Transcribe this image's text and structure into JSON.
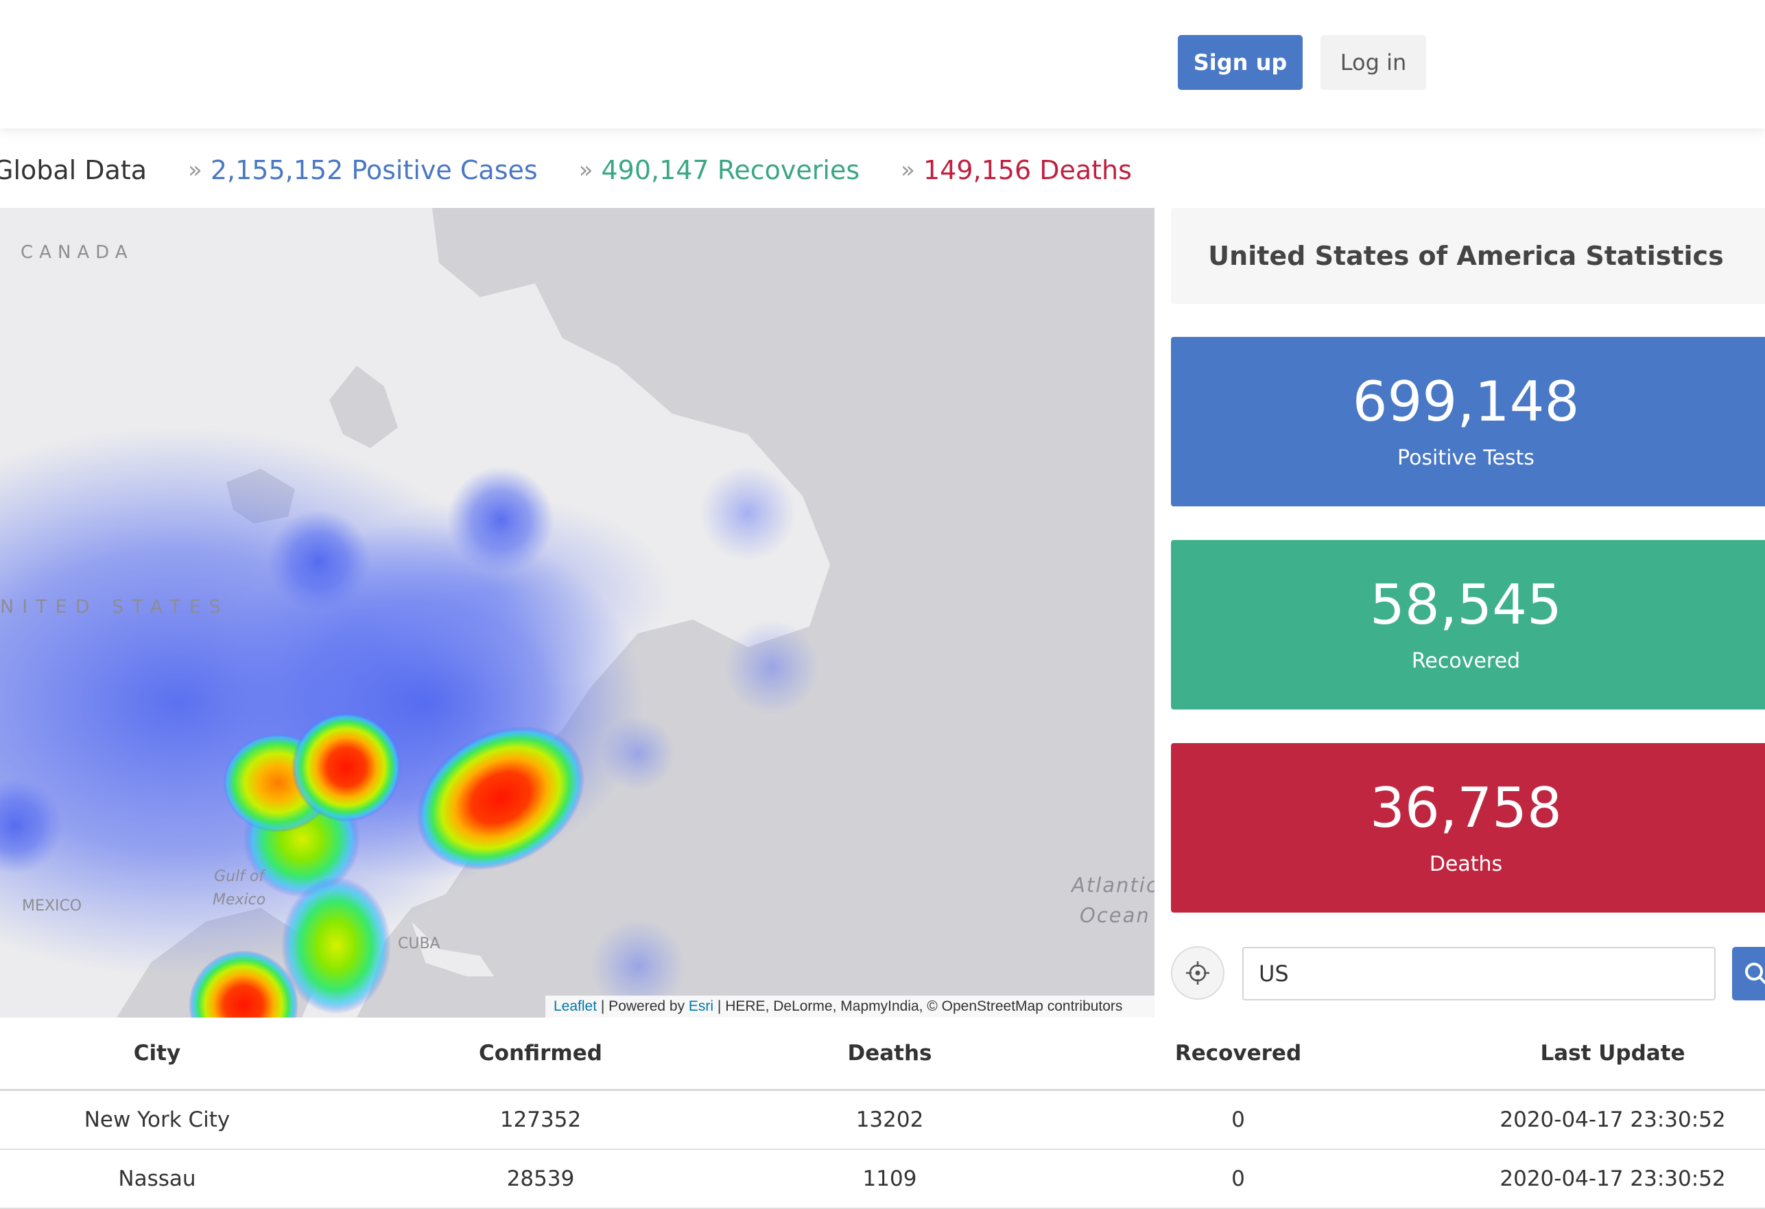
{
  "nav": {
    "signup_label": "Sign up",
    "login_label": "Log in"
  },
  "global": {
    "title": "Global Data",
    "cases": "2,155,152 Positive Cases",
    "recoveries": "490,147 Recoveries",
    "deaths": "149,156 Deaths"
  },
  "map": {
    "labels": {
      "canada": "CANADA",
      "united_states": "NITED STATES",
      "gulf_line1": "Gulf of",
      "gulf_line2": "Mexico",
      "mexico": "MEXICO",
      "cuba": "CUBA",
      "atlantic_line1": "Atlantic",
      "atlantic_line2": "Ocean"
    },
    "attribution": {
      "leaflet": "Leaflet",
      "powered_by": " | Powered by ",
      "esri": "Esri",
      "rest": " | HERE, DeLorme, MapmyIndia, © OpenStreetMap contributors"
    }
  },
  "panel": {
    "title": "United States of America Statistics",
    "positive": {
      "value": "699,148",
      "label": "Positive Tests"
    },
    "recovered": {
      "value": "58,545",
      "label": "Recovered"
    },
    "deaths": {
      "value": "36,758",
      "label": "Deaths"
    }
  },
  "search": {
    "value": "US",
    "locate_icon": "crosshair-icon",
    "search_icon": "search-icon"
  },
  "table": {
    "headers": [
      "City",
      "Confirmed",
      "Deaths",
      "Recovered",
      "Last Update"
    ],
    "rows": [
      [
        "New York City",
        "127352",
        "13202",
        "0",
        "2020-04-17 23:30:52"
      ],
      [
        "Nassau",
        "28539",
        "1109",
        "0",
        "2020-04-17 23:30:52"
      ]
    ]
  },
  "colors": {
    "primary": "#4878c6",
    "success": "#3eb08c",
    "danger": "#c0263f",
    "map_water": "#d2d2d6",
    "map_land": "#ececee"
  }
}
